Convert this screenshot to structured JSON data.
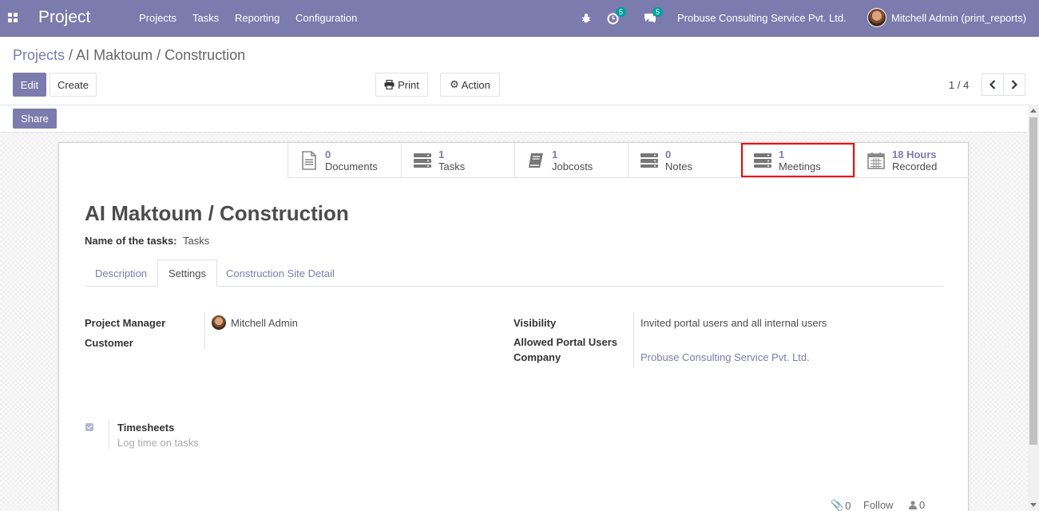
{
  "navbar": {
    "brand": "Project",
    "menu": [
      "Projects",
      "Tasks",
      "Reporting",
      "Configuration"
    ],
    "activity_count": "5",
    "messages_count": "5",
    "company": "Probuse Consulting Service Pvt. Ltd.",
    "user": "Mitchell Admin (print_reports)"
  },
  "breadcrumb": {
    "parent": "Projects",
    "separator": "/",
    "current": "AI Maktoum / Construction"
  },
  "toolbar": {
    "edit": "Edit",
    "create": "Create",
    "print": "Print",
    "action": "Action",
    "pager": "1 / 4",
    "share": "Share"
  },
  "stat_buttons": [
    {
      "value": "0",
      "label": "Documents",
      "icon": "document-icon"
    },
    {
      "value": "1",
      "label": "Tasks",
      "icon": "tasks-icon"
    },
    {
      "value": "1",
      "label": "Jobcosts",
      "icon": "book-icon"
    },
    {
      "value": "0",
      "label": "Notes",
      "icon": "notes-icon"
    },
    {
      "value": "1",
      "label": "Meetings",
      "icon": "meetings-icon"
    },
    {
      "value": "18 Hours",
      "label": "Recorded",
      "icon": "calendar-icon"
    }
  ],
  "form": {
    "title": "AI Maktoum / Construction",
    "tasks_label": "Name of the tasks:",
    "tasks_value": "Tasks",
    "tabs": [
      "Description",
      "Settings",
      "Construction Site Detail"
    ],
    "active_tab": "Settings",
    "project_manager_label": "Project Manager",
    "project_manager_value": "Mitchell Admin",
    "customer_label": "Customer",
    "visibility_label": "Visibility",
    "visibility_value": "Invited portal users and all internal users",
    "allowed_portal_label": "Allowed Portal Users",
    "company_label": "Company",
    "company_value": "Probuse Consulting Service Pvt. Ltd.",
    "timesheets_label": "Timesheets",
    "timesheets_help": "Log time on tasks",
    "timesheets_checked": true
  },
  "chatter": {
    "attachments": "0",
    "follow": "Follow",
    "followers": "0"
  },
  "colors": {
    "primary": "#7c7bad",
    "highlight": "#ee0000"
  }
}
